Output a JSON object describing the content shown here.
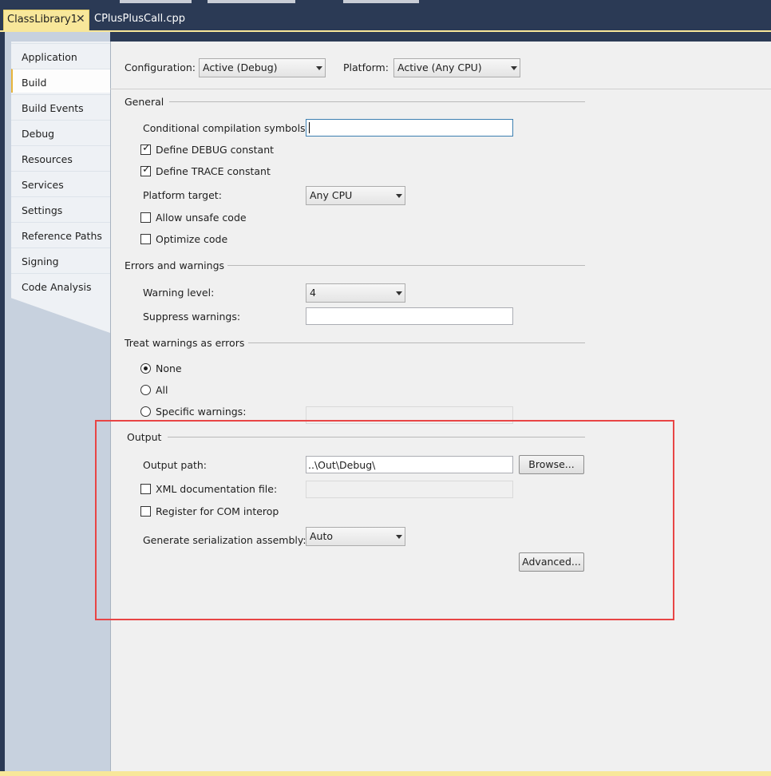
{
  "tabs": {
    "active": "ClassLibrary1",
    "active_close": "✕",
    "inactive": "CPlusPlusCall.cpp"
  },
  "nav": {
    "items": [
      "Application",
      "Build",
      "Build Events",
      "Debug",
      "Resources",
      "Services",
      "Settings",
      "Reference Paths",
      "Signing",
      "Code Analysis"
    ],
    "selected": "Build"
  },
  "header": {
    "configuration_label": "Configuration:",
    "configuration_value": "Active (Debug)",
    "platform_label": "Platform:",
    "platform_value": "Active (Any CPU)"
  },
  "general": {
    "title": "General",
    "cond_symbols_label": "Conditional compilation symbols:",
    "cond_symbols_value": "",
    "define_debug_label": "Define DEBUG constant",
    "define_debug_checked": true,
    "define_trace_label": "Define TRACE constant",
    "define_trace_checked": true,
    "platform_target_label": "Platform target:",
    "platform_target_value": "Any CPU",
    "allow_unsafe_label": "Allow unsafe code",
    "allow_unsafe_checked": false,
    "optimize_label": "Optimize code",
    "optimize_checked": false
  },
  "errors": {
    "title": "Errors and warnings",
    "warning_level_label": "Warning level:",
    "warning_level_value": "4",
    "suppress_label": "Suppress warnings:",
    "suppress_value": ""
  },
  "treat": {
    "title": "Treat warnings as errors",
    "none_label": "None",
    "all_label": "All",
    "specific_label": "Specific warnings:",
    "selected": "None"
  },
  "output": {
    "title": "Output",
    "path_label": "Output path:",
    "path_value": "..\\Out\\Debug\\",
    "browse_label": "Browse...",
    "xml_doc_label": "XML documentation file:",
    "xml_doc_checked": false,
    "com_interop_label": "Register for COM interop",
    "com_interop_checked": false,
    "serialization_label": "Generate serialization assembly:",
    "serialization_value": "Auto",
    "advanced_label": "Advanced..."
  },
  "colors": {
    "highlight_box": "#e84545",
    "active_tab": "#f8e79a",
    "chrome": "#2b3a55"
  }
}
